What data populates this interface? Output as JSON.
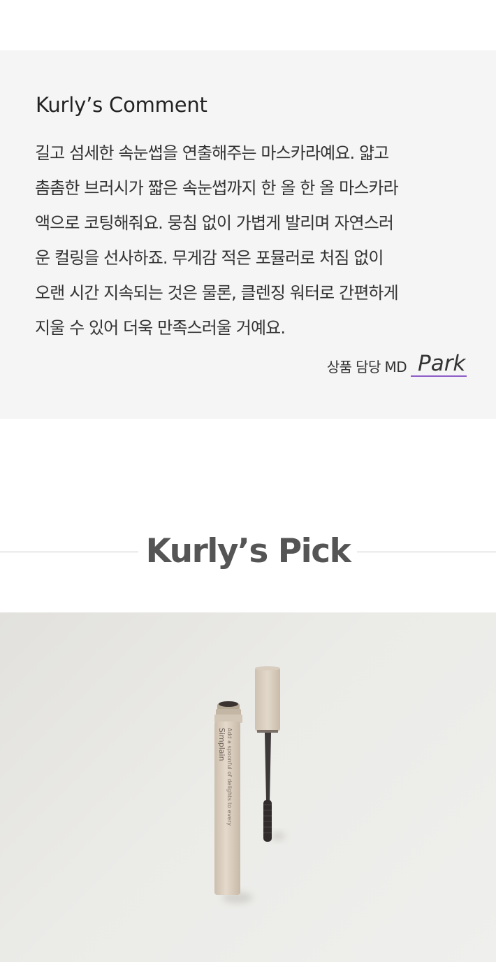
{
  "comment": {
    "title": "Kurly’s Comment",
    "lines": [
      "길고 섬세한 속눈썹을 연출해주는 마스카라예요. 얇고",
      "촘촘한 브러시가 짧은 속눈썹까지 한 올 한 올 마스카라",
      "액으로 코팅해줘요. 뭉침 없이 가볍게 발리며 자연스러",
      "운 컬링을 선사하죠. 무게감 적은 포뮬러로 처짐 없이",
      "오랜 시간 지속되는 것은 물론, 클렌징 워터로 간편하게",
      "지울 수 있어 더욱 만족스러울 거예요."
    ],
    "md_label": "상품 담당 MD",
    "md_signature": "Park",
    "signature_underline_color": "#8e5cc7"
  },
  "pick": {
    "title": "Kurly’s Pick"
  },
  "product_image": {
    "alt": "mascara product photo",
    "brand_text": "Simplain",
    "tagline_text": "Add a spoonful of delights to every"
  }
}
